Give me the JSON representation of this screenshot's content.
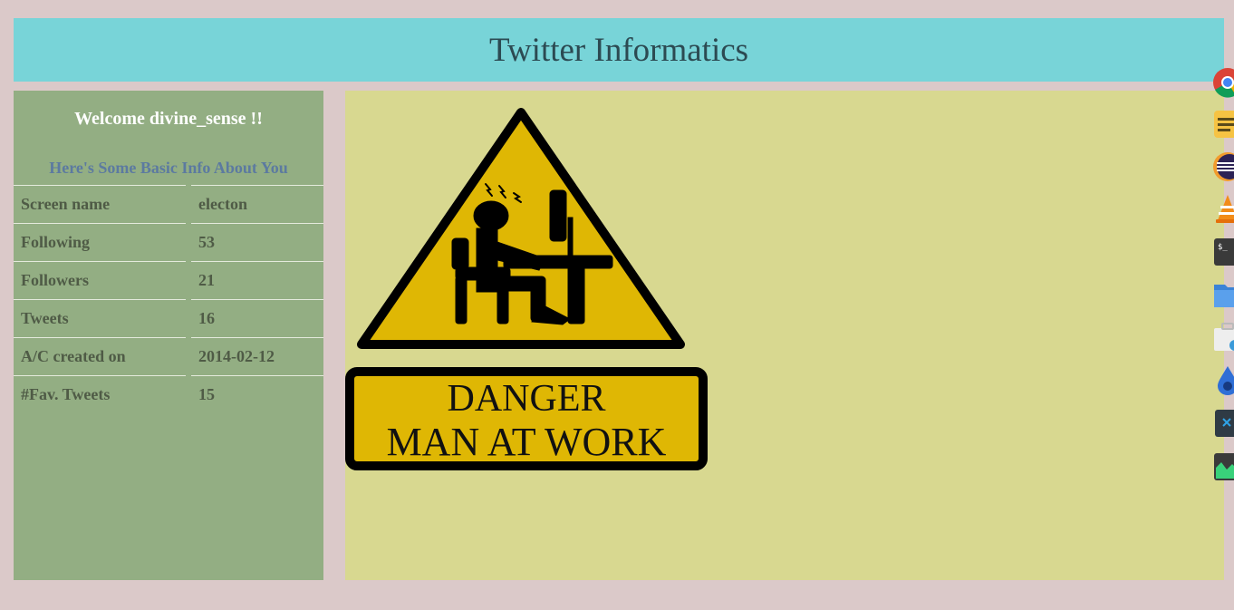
{
  "header": {
    "title": "Twitter Informatics"
  },
  "sidebar": {
    "welcome": "Welcome divine_sense !!",
    "subtitle": "Here's Some Basic Info About You",
    "rows": [
      {
        "label": "Screen name",
        "value": "electon"
      },
      {
        "label": "Following",
        "value": "53"
      },
      {
        "label": "Followers",
        "value": "21"
      },
      {
        "label": "Tweets",
        "value": "16"
      },
      {
        "label": "A/C created on",
        "value": "2014-02-12"
      },
      {
        "label": "#Fav. Tweets",
        "value": "15"
      }
    ]
  },
  "main": {
    "sign": {
      "line1": "DANGER",
      "line2": "MAN AT WORK"
    }
  },
  "dock": {
    "icons": [
      "chrome-icon",
      "notes-icon",
      "eclipse-icon",
      "vlc-icon",
      "terminal-icon",
      "files-icon",
      "software-store-icon",
      "water-drop-icon",
      "code-editor-icon",
      "system-monitor-icon"
    ]
  },
  "colors": {
    "header_bg": "#78d4d8",
    "sidebar_bg": "#93ae83",
    "main_bg": "#d8d890",
    "page_bg": "#dbc9c9",
    "sign_yellow": "#dfb704"
  }
}
